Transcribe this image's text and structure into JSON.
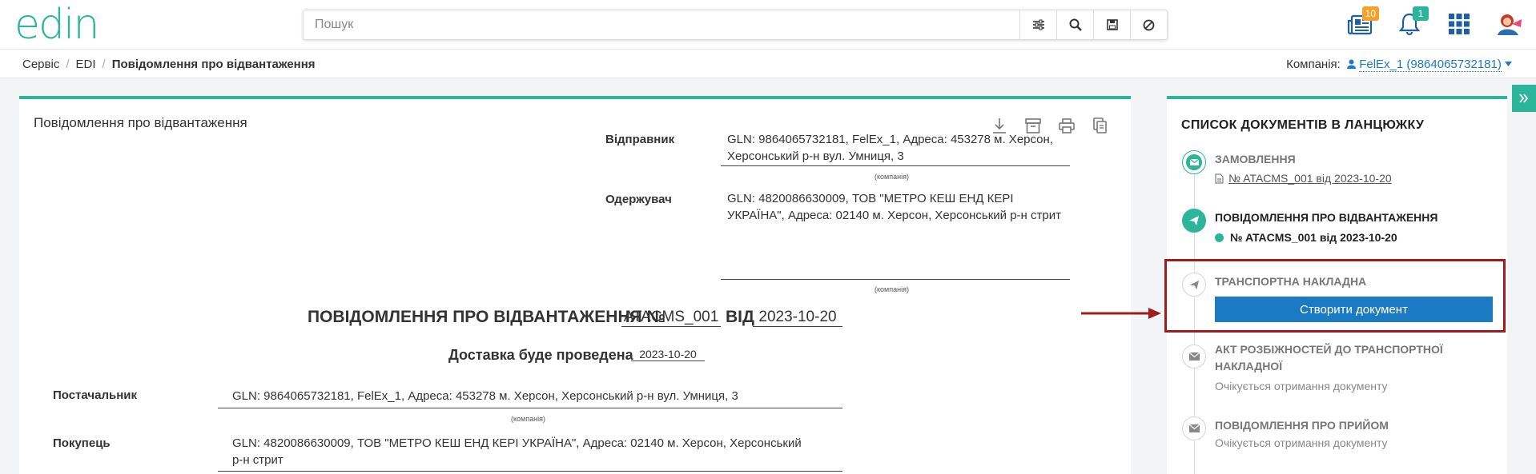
{
  "header": {
    "logo_text": "edin",
    "search": {
      "placeholder": "Пошук",
      "value": ""
    },
    "icons": {
      "filter": "sliders-icon",
      "search": "search-icon",
      "save": "save-icon",
      "clear": "block-icon",
      "news": "newspaper-icon",
      "notifications": "bell-icon",
      "apps": "grid-icon",
      "profile": "avatar"
    },
    "news_badge": "10",
    "notifications_badge": "1"
  },
  "breadcrumb": {
    "items": [
      "Сервіс",
      "EDI"
    ],
    "separator": "/",
    "current": "Повідомлення про відвантаження"
  },
  "company": {
    "label": "Компанія:",
    "value": "FelEx_1 (9864065732181)"
  },
  "document": {
    "panel_title": "Повідомлення про відвантаження",
    "tools": [
      "download-icon",
      "archive-icon",
      "print-icon",
      "copy-icon"
    ],
    "sender_label": "Відправник",
    "sender_value": "GLN: 9864065732181, FelEx_1, Адреса: 453278 м. Херсон, Херсонський р-н вул. Умниця, 3",
    "receiver_label": "Одержувач",
    "receiver_value": "GLN: 4820086630009, ТОВ \"МЕТРО КЕШ ЕНД КЕРІ УКРАЇНА\", Адреса: 02140 м. Херсон, Херсонський р-н стрит",
    "company_caption": "(компанія)",
    "title_prefix": "ПОВІДОМЛЕННЯ ПРО ВІДВАНТАЖЕННЯ №",
    "number": "ATACMS_001",
    "date_label": "ВІД",
    "date": "2023-10-20",
    "delivery_label": "Доставка буде проведена",
    "delivery_date": "2023-10-20",
    "supplier_label": "Постачальник",
    "supplier_value": "GLN: 9864065732181, FelEx_1, Адреса: 453278 м. Херсон, Херсонський р-н вул. Умниця, 3",
    "buyer_label": "Покупець",
    "buyer_value": "GLN: 4820086630009, ТОВ \"МЕТРО КЕШ ЕНД КЕРІ УКРАЇНА\", Адреса: 02140 м. Херсон, Херсонський р-н стрит"
  },
  "chain": {
    "title": "СПИСОК ДОКУМЕНТІВ В ЛАНЦЮЖКУ",
    "steps": [
      {
        "title": "ЗАМОВЛЕННЯ",
        "link": "№ ATACMS_001 від 2023-10-20",
        "icon": "envelope-icon"
      },
      {
        "title": "ПОВІДОМЛЕННЯ ПРО ВІДВАНТАЖЕННЯ",
        "link": "№ ATACMS_001 від 2023-10-20",
        "icon": "paper-plane-icon"
      },
      {
        "title": "ТРАНСПОРТНА НАКЛАДНА",
        "button": "Створити документ",
        "icon": "paper-plane-icon"
      },
      {
        "title_line1": "АКТ РОЗБІЖНОСТЕЙ ДО ТРАНСПОРТНОЇ",
        "title_line2": "НАКЛАДНОЇ",
        "status": "Очікується отримання документу",
        "icon": "envelope-icon"
      },
      {
        "title": "ПОВІДОМЛЕННЯ ПРО ПРИЙОМ",
        "status": "Очікується отримання документу",
        "icon": "envelope-icon"
      }
    ]
  },
  "colors": {
    "accent": "#2bb59a",
    "primary_button": "#1a7bc4",
    "highlight": "#a01c1c"
  }
}
